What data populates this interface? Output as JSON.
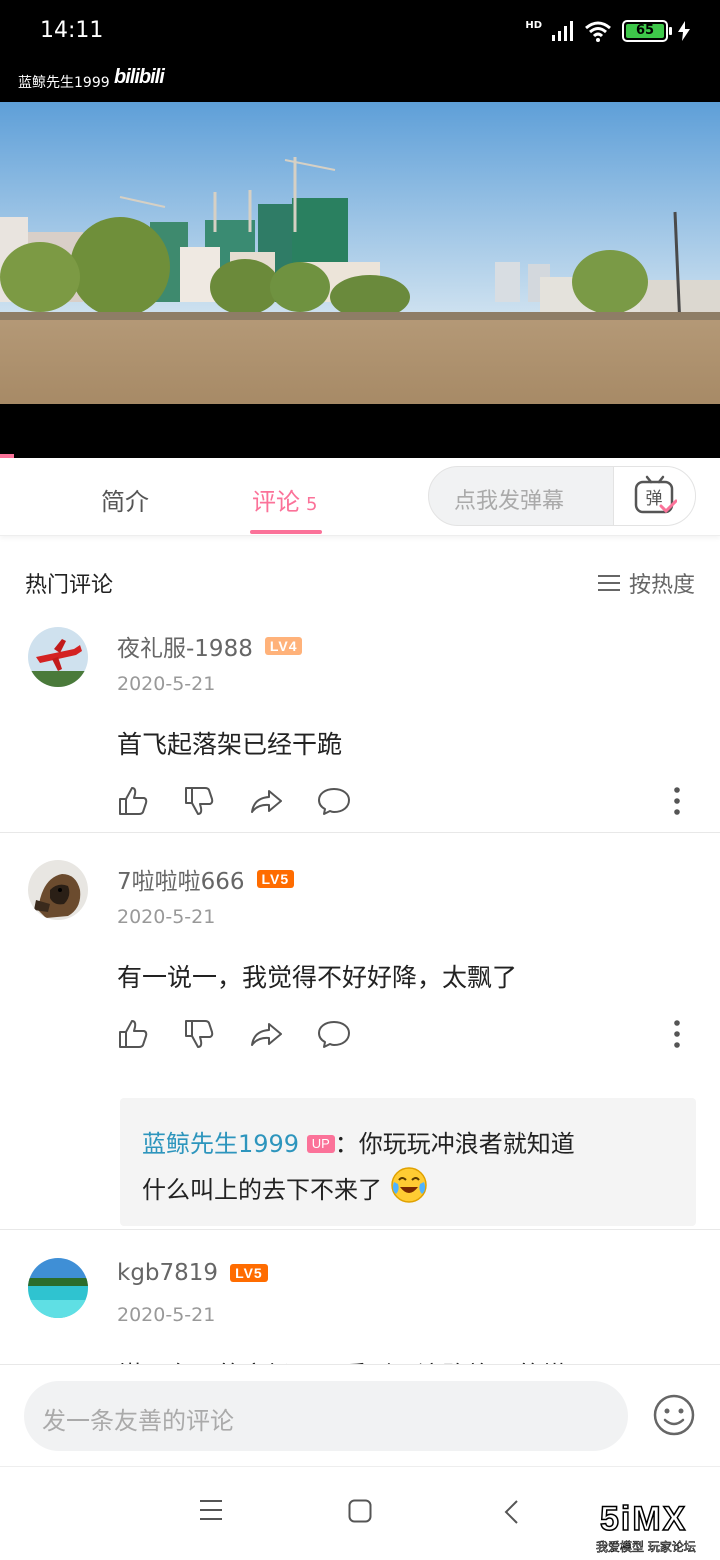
{
  "status_bar": {
    "time": "14:11",
    "network": "HD",
    "battery": "65"
  },
  "video": {
    "uploader_watermark": "蓝鲸先生1999",
    "brand_logo": "bilibili"
  },
  "tabs": {
    "intro": "简介",
    "comments": "评论",
    "comment_count": "5",
    "danmaku_placeholder": "点我发弹幕",
    "danmaku_button": "弹"
  },
  "hot_comments": {
    "title": "热门评论",
    "sort_label": "按热度"
  },
  "comments": [
    {
      "username": "夜礼服-1988",
      "level": "LV4",
      "date": "2020-5-21",
      "text": "首飞起落架已经干跪"
    },
    {
      "username": "7啦啦啦666",
      "level": "LV5",
      "date": "2020-5-21",
      "text": "有一说一，我觉得不好好降，太飘了",
      "reply": {
        "name": "蓝鲸先生1999",
        "badge": "UP",
        "separator": "：",
        "text_line1": "你玩玩冲浪者就知道",
        "text_line2": "什么叫上的去下不来了"
      }
    },
    {
      "username": "kgb7819",
      "level": "LV5",
      "date": "2020-5-21",
      "text": "煤厂东面的空场吧，看到开济路施工的塔吊"
    }
  ],
  "comment_input": {
    "placeholder": "发一条友善的评论"
  },
  "watermark": {
    "big": "5iMX",
    "small": "我爱模型 玩家论坛"
  },
  "colors": {
    "accent": "#fb7299",
    "reply_name": "#2d95bd",
    "lv4": "#ffb27a",
    "lv5": "#ff6c00"
  }
}
